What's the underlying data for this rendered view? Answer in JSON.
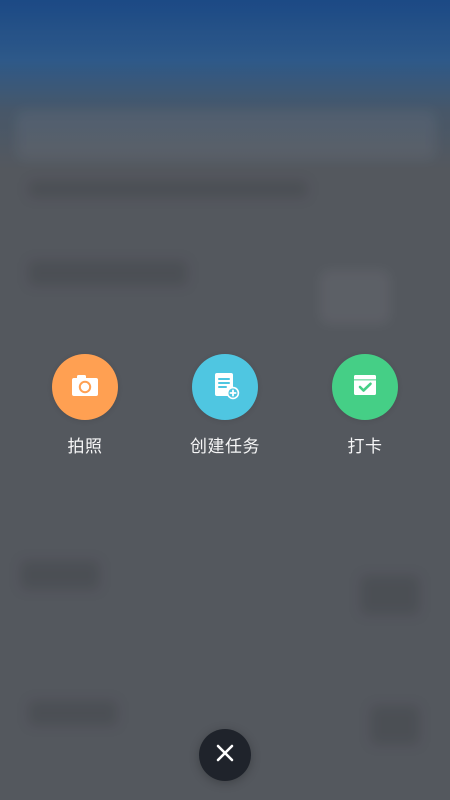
{
  "actions": {
    "photo": {
      "label": "拍照",
      "icon": "camera-icon",
      "color": "#FFA052"
    },
    "create_task": {
      "label": "创建任务",
      "icon": "document-add-icon",
      "color": "#4FC6E1"
    },
    "check_in": {
      "label": "打卡",
      "icon": "calendar-check-icon",
      "color": "#45CF86"
    }
  },
  "close": {
    "icon": "close-icon",
    "background": "#1F232B"
  }
}
